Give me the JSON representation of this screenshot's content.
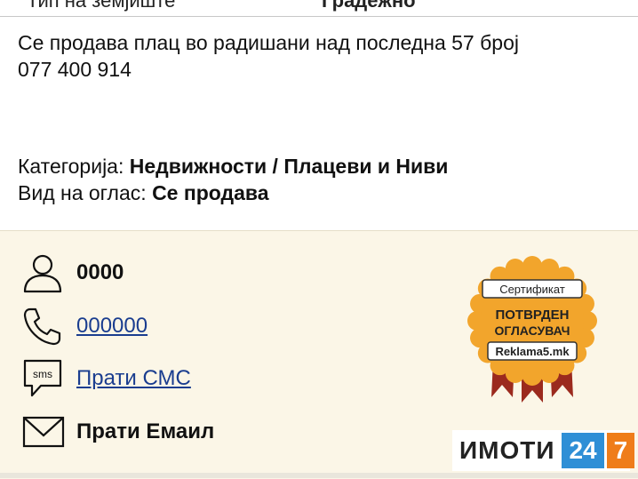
{
  "top_row": {
    "label": "Тип на земјиште",
    "value": "Градежно"
  },
  "description": {
    "line1": "Се продава плац во радишани над последна 57 број",
    "line2": "077 400 914"
  },
  "meta": {
    "category_label": "Категорија:",
    "category_value": "Недвижности / Плацеви и Ниви",
    "ad_type_label": "Вид на оглас:",
    "ad_type_value": "Се продава"
  },
  "contact": {
    "name": "0000",
    "phone": "000000",
    "sms_icon_text": "sms",
    "sms_label": "Прати СМС",
    "email_label": "Прати Емаил"
  },
  "badge": {
    "top": "Сертификат",
    "line1": "ПОТВРДЕН",
    "line2": "ОГЛАСУВАЧ",
    "site": "Reklama5.mk"
  },
  "brand": {
    "word": "ИМОТИ",
    "num1": "24",
    "num2": "7"
  },
  "colors": {
    "panel_bg": "#fbf6e7",
    "badge_orange": "#f2a52c",
    "ribbon_red": "#9b2a1e",
    "link": "#1a3d8f"
  }
}
